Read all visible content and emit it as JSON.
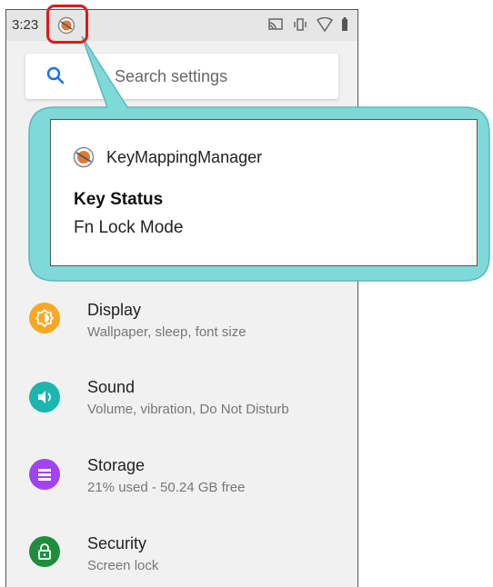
{
  "status_bar": {
    "time": "3:23",
    "icons": [
      "keymapping-status-icon",
      "cast-icon",
      "vibrate-icon",
      "wifi-icon",
      "battery-icon"
    ]
  },
  "search": {
    "placeholder": "Search settings"
  },
  "notification": {
    "app_name": "KeyMappingManager",
    "title": "Key Status",
    "text": "Fn Lock Mode"
  },
  "settings": {
    "items": [
      {
        "title": "Display",
        "subtitle": "Wallpaper, sleep, font size",
        "icon": "display-icon",
        "color": "#F9A825"
      },
      {
        "title": "Sound",
        "subtitle": "Volume, vibration, Do Not Disturb",
        "icon": "sound-icon",
        "color": "#1BB6AE"
      },
      {
        "title": "Storage",
        "subtitle": "21% used - 50.24 GB free",
        "icon": "storage-icon",
        "color": "#A142F4"
      },
      {
        "title": "Security",
        "subtitle": "Screen lock",
        "icon": "lock-icon",
        "color": "#1E8E3E"
      }
    ]
  },
  "colors": {
    "highlight": "#E0181B",
    "callout": "#7ED9D9",
    "search_icon": "#1A73E8"
  }
}
